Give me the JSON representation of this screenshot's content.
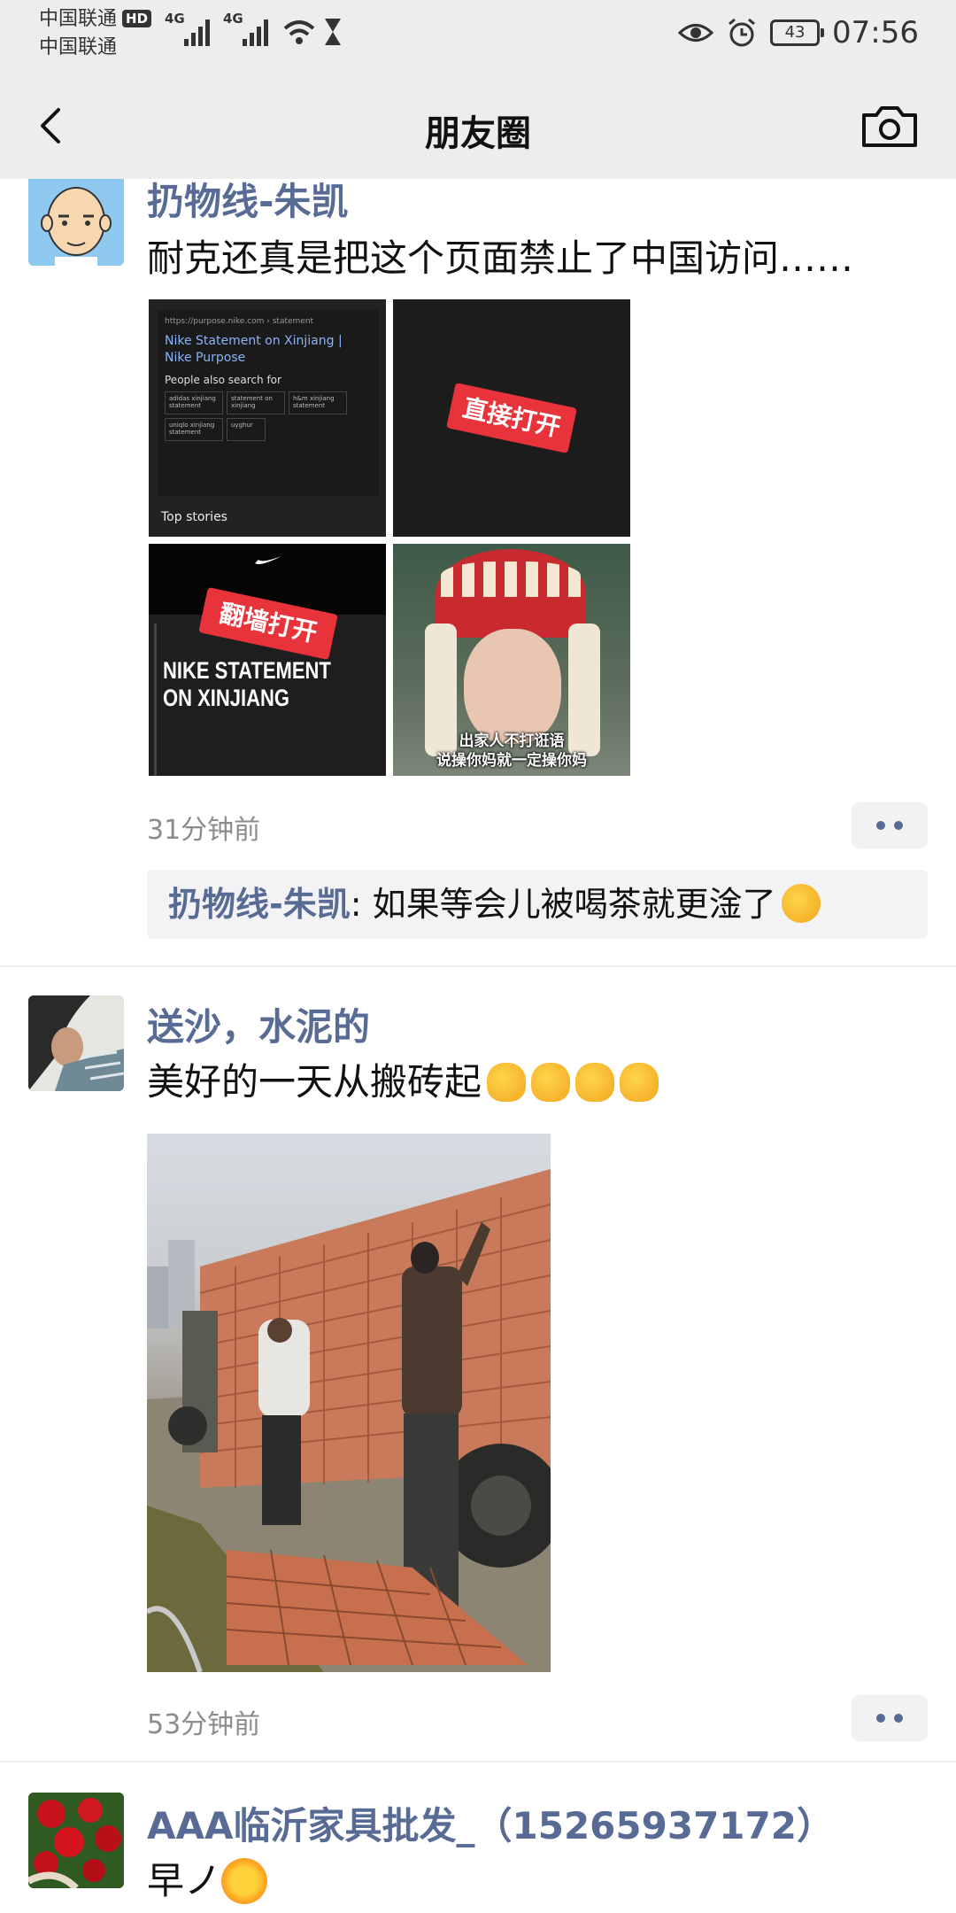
{
  "status_bar": {
    "carrier_1": "中国联通",
    "carrier_1_badge": "HD",
    "carrier_2": "中国联通",
    "signal_1_label": "4G",
    "signal_2_label": "4G",
    "battery": "43",
    "time": "07:56"
  },
  "nav": {
    "title": "朋友圈",
    "back_icon": "chevron-left-icon",
    "camera_icon": "camera-icon"
  },
  "posts": [
    {
      "author": "扔物线-朱凯",
      "text": "耐克还真是把这个页面禁止了中国访问……",
      "images": {
        "img1": {
          "url_text": "https://purpose.nike.com › statement",
          "result_title": "Nike Statement on Xinjiang | Nike Purpose",
          "people_search": "People also search for",
          "chips": [
            "adidas xinjiang statement",
            "statement on xinjiang",
            "h&m xinjiang statement",
            "uniqlo xinjiang statement",
            "uyghur"
          ],
          "top_stories": "Top stories"
        },
        "img2": {
          "stamp": "直接打开"
        },
        "img3": {
          "stamp": "翻墙打开",
          "headline_1": "NIKE STATEMENT",
          "headline_2": "ON XINJIANG"
        },
        "img4": {
          "caption_1": "出家人不打诳语",
          "caption_2": "说操你妈就一定操你妈"
        }
      },
      "time": "31分钟前",
      "comment": {
        "author": "扔物线-朱凯",
        "separator": ": ",
        "text": "如果等会儿被喝茶就更淦了"
      }
    },
    {
      "author": "送沙，水泥的",
      "text": "美好的一天从搬砖起",
      "time": "53分钟前"
    },
    {
      "author": "AAA临沂家具批发_（15265937172）",
      "text": "早ノ"
    }
  ],
  "colors": {
    "link": "#576b95",
    "bar_bg": "#ededed",
    "comment_bg": "#f3f3f5",
    "stamp_red": "#e8333a"
  }
}
